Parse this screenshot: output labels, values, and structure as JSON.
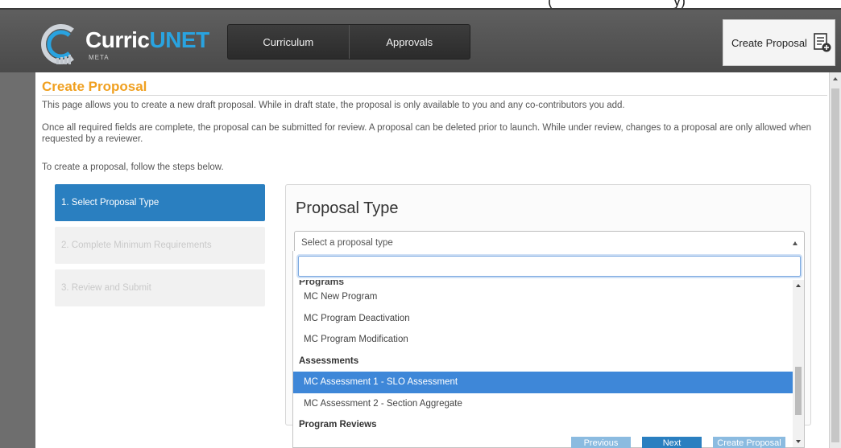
{
  "top_cutoff_text": "(                              y)",
  "header": {
    "logo_word_main": "Curric",
    "logo_word_accent": "UNET",
    "logo_sub": "META",
    "nav_tabs": [
      {
        "label": "Curriculum"
      },
      {
        "label": "Approvals"
      }
    ],
    "create_proposal_label": "Create Proposal"
  },
  "page": {
    "title": "Create Proposal",
    "desc1": "This page allows you to create a new draft proposal. While in draft state, the proposal is only available to you and any co-contributors you add.",
    "desc2": "Once all required fields are complete, the proposal can be submitted for review. A proposal can be deleted prior to launch. While under review, changes to a proposal are only allowed when requested by a reviewer.",
    "desc3": "To create a proposal, follow the steps below."
  },
  "steps": [
    {
      "label": "1. Select Proposal Type"
    },
    {
      "label": "2. Complete Minimum Requirements"
    },
    {
      "label": "3. Review and Submit"
    }
  ],
  "panel": {
    "title": "Proposal Type",
    "select_placeholder": "Select a proposal type"
  },
  "dropdown": {
    "search_value": "",
    "partial_group": "Programs",
    "options": [
      {
        "label": "MC New Program",
        "type": "option"
      },
      {
        "label": "MC Program Deactivation",
        "type": "option"
      },
      {
        "label": "MC Program Modification",
        "type": "option"
      },
      {
        "label": "Assessments",
        "type": "group"
      },
      {
        "label": "MC Assessment 1 - SLO Assessment",
        "type": "option",
        "selected": true
      },
      {
        "label": "MC Assessment 2 - Section Aggregate",
        "type": "option"
      },
      {
        "label": "Program Reviews",
        "type": "group"
      }
    ]
  },
  "footer": {
    "previous_label": "Previous",
    "next_label": "Next",
    "create_label": "Create Proposal"
  },
  "colors": {
    "accent_orange": "#f0a020",
    "active_blue": "#2a7fc0",
    "selected_blue": "#3e87d8"
  }
}
